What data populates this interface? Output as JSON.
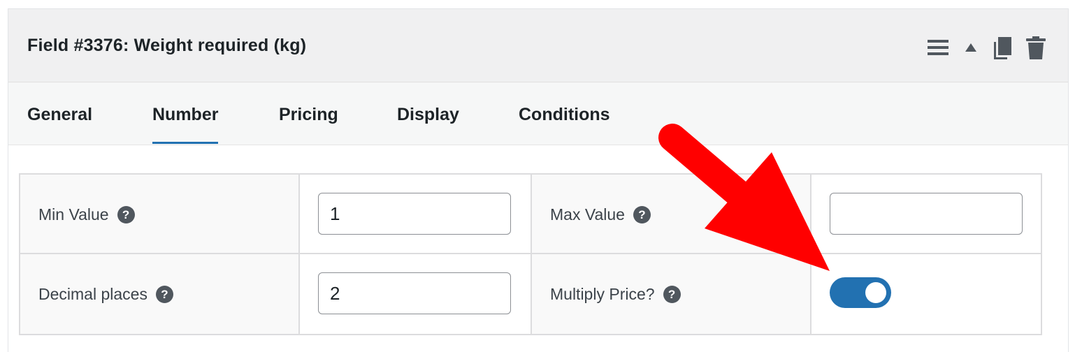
{
  "field": {
    "title": "Field #3376: Weight required (kg)"
  },
  "header_icons": [
    "menu-icon",
    "collapse-up-icon",
    "duplicate-icon",
    "trash-icon"
  ],
  "tabs": [
    {
      "label": "General",
      "active": false
    },
    {
      "label": "Number",
      "active": true
    },
    {
      "label": "Pricing",
      "active": false
    },
    {
      "label": "Display",
      "active": false
    },
    {
      "label": "Conditions",
      "active": false
    }
  ],
  "settings": {
    "min_value": {
      "label": "Min Value",
      "value": "1",
      "help": "?"
    },
    "max_value": {
      "label": "Max Value",
      "value": "",
      "help": "?"
    },
    "decimal_places": {
      "label": "Decimal places",
      "value": "2",
      "help": "?"
    },
    "multiply_price": {
      "label": "Multiply Price?",
      "enabled": true,
      "help": "?"
    }
  },
  "colors": {
    "accent": "#2271b1",
    "header_bg": "#f0f0f1",
    "annotation_arrow": "#ff0000"
  }
}
